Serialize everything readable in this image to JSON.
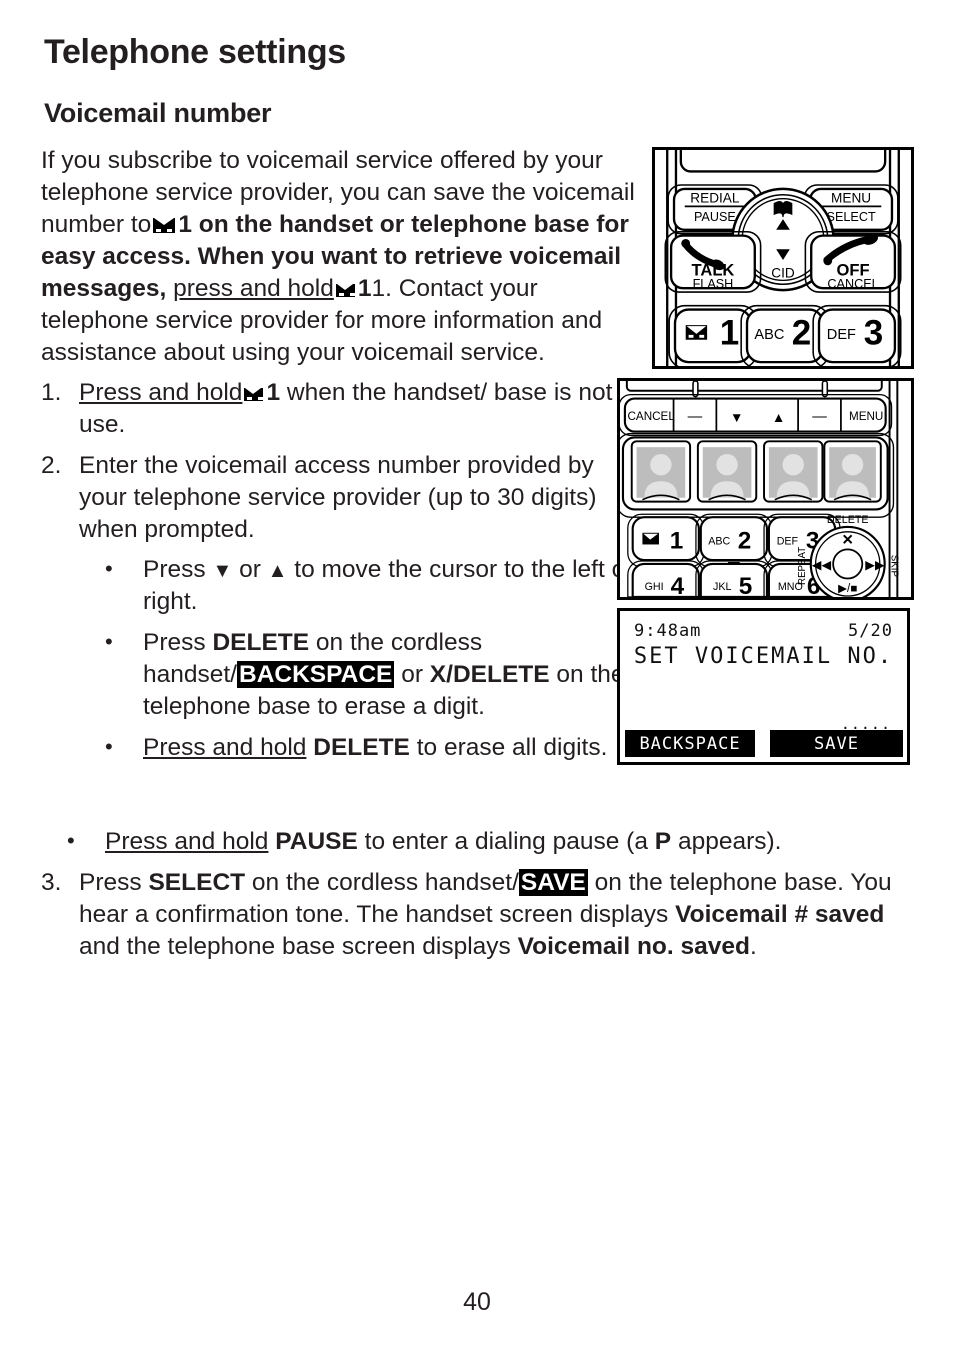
{
  "page": {
    "chapter_title": "Telephone settings",
    "section_title": "Voicemail number",
    "page_number": "40"
  },
  "intro": {
    "t1": "If you subscribe to voicemail service offered by your telephone service provider, you can save the voicemail number to",
    "t2": "1 on the handset or telephone base for easy access. When you want to retrieve voicemail messages,",
    "press_and_hold": "press and hold",
    "t3": "1. Contact your telephone service provider for more information and assistance about using your voicemail service."
  },
  "steps": [
    {
      "num": "1.",
      "press_and_hold": "Press and hold",
      "icon": "envelope-icon",
      "key": "1",
      "rest": "when the handset/ base is not in use."
    },
    {
      "num": "2.",
      "text": "Enter the voicemail access number provided by your telephone service provider (up to 30 digits) when prompted."
    },
    {
      "num": "3.",
      "a": "Press",
      "select": "SELECT",
      "b": "on the cordless handset/",
      "save": "SAVE",
      "c": "on the telephone base. You hear a confirmation tone. The handset screen displays",
      "d": "Voicemail # saved",
      "e": "and the telephone base screen displays",
      "f": "Voicemail no. saved",
      "g": "."
    }
  ],
  "bullets": {
    "b1": {
      "a": "Press",
      "down": "▼",
      "or": "or",
      "up": "▲",
      "b": "to move the cursor to the left or right."
    },
    "b2": {
      "a": "Press",
      "delete": "DELETE",
      "b": "on the cordless handset/",
      "backspace": "BACKSPACE",
      "c": "or",
      "xdelete": "X/DELETE",
      "d": "on the telephone base to erase a digit."
    },
    "b3": {
      "press_and_hold": "Press and hold",
      "delete": "DELETE",
      "rest": "to erase all digits."
    },
    "b4": {
      "press_and_hold": "Press and hold",
      "pause": "PAUSE",
      "a": "to enter a dialing pause (a",
      "p": "P",
      "b": "appears)."
    }
  },
  "figures": {
    "handset": {
      "name": "cordless-handset-keypad",
      "keys": {
        "redial": "REDIAL",
        "pause": "PAUSE",
        "menu": "MENU",
        "select": "SELECT",
        "talk": "TALK",
        "flash": "FLASH",
        "off": "OFF",
        "cancel": "CANCEL",
        "cid": "CID",
        "key1_letters": "",
        "key1_digit": "1",
        "key2_letters": "ABC",
        "key2_digit": "2",
        "key3_letters": "DEF",
        "key3_digit": "3"
      }
    },
    "base": {
      "name": "telephone-base-keypad",
      "soft_keys": [
        "CANCEL",
        "—",
        "▼",
        "▲",
        "—",
        "MENU"
      ],
      "keys": {
        "key1_digit": "1",
        "key2_letters": "ABC",
        "key2_digit": "2",
        "key3_letters": "DEF",
        "key3_digit": "3",
        "key4_letters": "GHI",
        "key4_digit": "4",
        "key5_letters": "JKL",
        "key5_digit": "5",
        "key6_letters": "MNO",
        "key6_digit": "6"
      },
      "nav": {
        "delete": "DELETE",
        "repeat": "REPEAT",
        "skip": "SKIP",
        "playstop": "▶/■",
        "x": "✕",
        "rew": "◀◀",
        "ff": "▶▶"
      }
    },
    "lcd": {
      "name": "telephone-base-screen",
      "time": "9:48am",
      "date": "5/20",
      "title": "SET VOICEMAIL NO.",
      "dots": ".....",
      "softkey_left": "BACKSPACE",
      "softkey_right": "SAVE"
    }
  },
  "colors": {
    "ink": "#231f20",
    "paper": "#ffffff",
    "figure_border": "#000000",
    "lcd_invert_bg": "#000000"
  }
}
